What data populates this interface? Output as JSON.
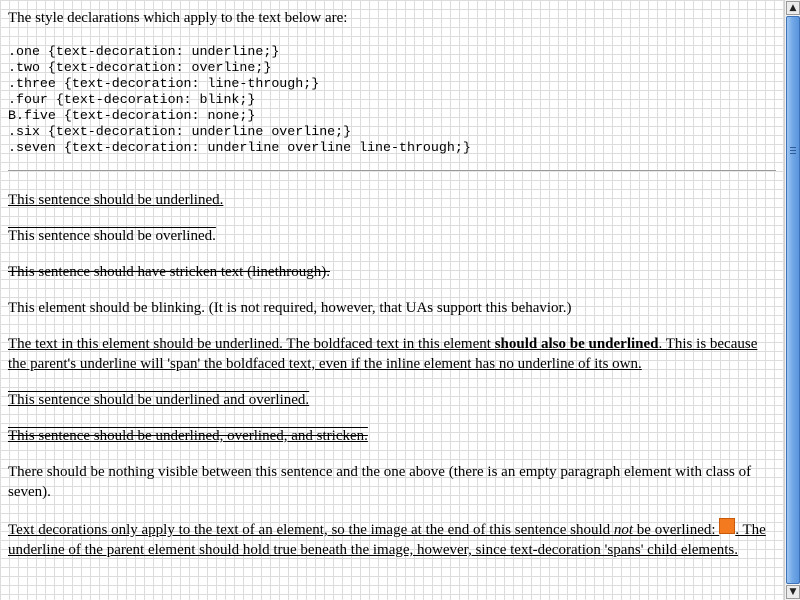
{
  "intro": "The style declarations which apply to the text below are:",
  "code_lines": [
    ".one {text-decoration: underline;}",
    ".two {text-decoration: overline;}",
    ".three {text-decoration: line-through;}",
    ".four {text-decoration: blink;}",
    "B.five {text-decoration: none;}",
    ".six {text-decoration: underline overline;}",
    ".seven {text-decoration: underline overline line-through;}"
  ],
  "paragraphs": {
    "one": "This sentence should be underlined.",
    "two": "This sentence should be overlined.",
    "three": "This sentence should have stricken text (linethrough).",
    "four": "This element should be blinking. (It is not required, however, that UAs support this behavior.)",
    "five_before": "The text in this element should be underlined. The boldfaced text in this element ",
    "five_bold": "should also be underlined",
    "five_after": ". This is because the parent's underline will 'span' the boldfaced text, even if the inline element has no underline of its own.",
    "six": "This sentence should be underlined and overlined.",
    "seven": "This sentence should be underlined, overlined, and stricken.",
    "nothing": "There should be nothing visible between this sentence and the one above (there is an empty paragraph element with class of seven).",
    "last_before": "Text decorations only apply to the text of an element, so the image at the end of this sentence should ",
    "last_em": "not",
    "last_middle": " be overlined: ",
    "last_after": ". The underline of the parent element should hold true beneath the image, however, since text-decoration 'spans' child elements."
  },
  "image_icon": "orange-square",
  "colors": {
    "image_fill": "#f37a1f",
    "scrollbar_thumb": "#6fa6e6"
  },
  "scrollbar": {
    "up_arrow": "▲",
    "down_arrow": "▼"
  }
}
